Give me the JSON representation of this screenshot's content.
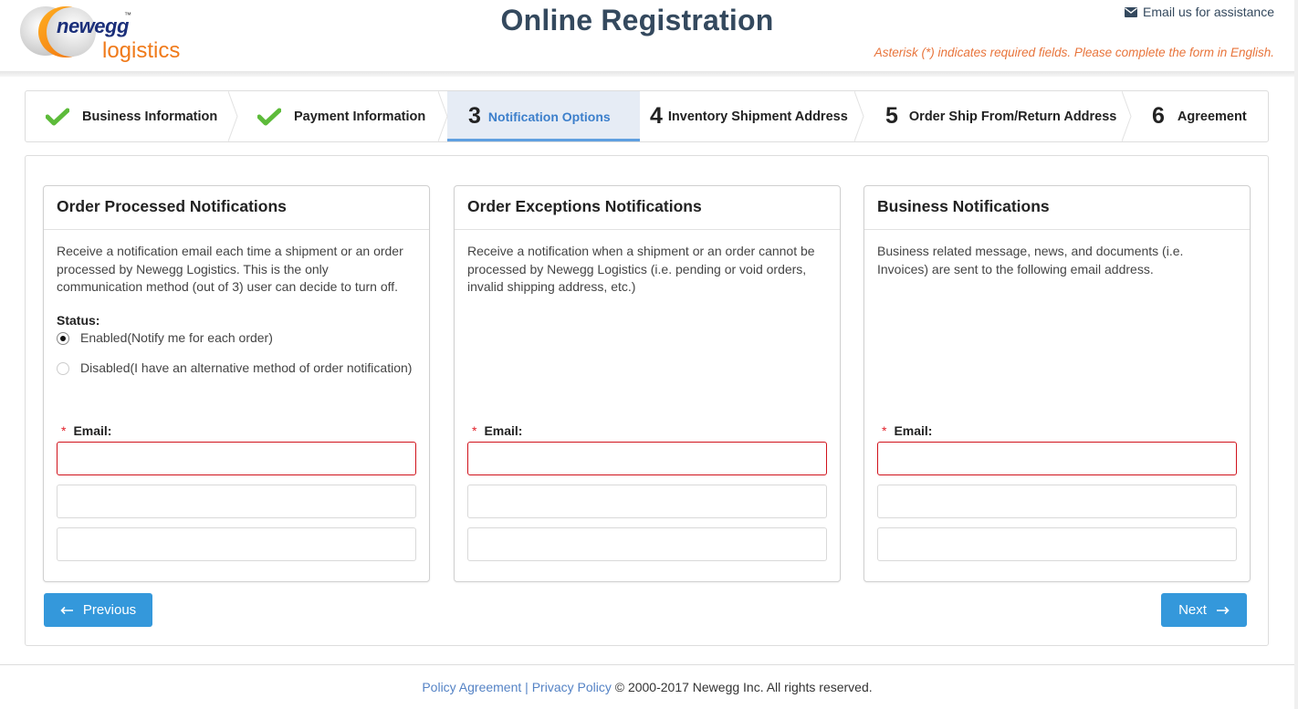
{
  "header": {
    "logo_text_top": "newegg",
    "logo_tm": "™",
    "logo_text_bottom": "logistics",
    "title": "Online Registration",
    "email_help": "Email us for assistance",
    "email_icon": "envelope-icon",
    "asterisk_note": "Asterisk (*) indicates required fields. Please complete the form in English."
  },
  "steps": [
    {
      "marker": "check",
      "icon": "checkmark-icon",
      "label": "Business Information",
      "state": "completed"
    },
    {
      "marker": "check",
      "icon": "checkmark-icon",
      "label": "Payment Information",
      "state": "completed"
    },
    {
      "marker": "3",
      "label": "Notification Options",
      "state": "active"
    },
    {
      "marker": "4",
      "label": "Inventory Shipment Address",
      "state": "pending"
    },
    {
      "marker": "5",
      "label": "Order Ship From/Return Address",
      "state": "pending"
    },
    {
      "marker": "6",
      "label": "Agreement",
      "state": "pending"
    }
  ],
  "cards": [
    {
      "title": "Order Processed Notifications",
      "description": "Receive a notification email each time a shipment or an order processed by Newegg Logistics. This is the only communication method (out of 3) user can decide to turn off.",
      "status_label": "Status:",
      "options": [
        {
          "label": "Enabled(Notify me for each order)",
          "checked": true
        },
        {
          "label": "Disabled(I have an alternative method of order notification)",
          "checked": false
        }
      ],
      "email_required_mark": "*",
      "email_label": "Email:",
      "emails": [
        "",
        "",
        ""
      ]
    },
    {
      "title": "Order Exceptions Notifications",
      "description": "Receive a notification when a shipment or an order cannot be processed by Newegg Logistics (i.e. pending or void orders, invalid shipping address, etc.)",
      "email_required_mark": "*",
      "email_label": "Email:",
      "emails": [
        "",
        "",
        ""
      ]
    },
    {
      "title": "Business Notifications",
      "description": "Business related message, news, and documents (i.e. Invoices) are sent to the following email address.",
      "email_required_mark": "*",
      "email_label": "Email:",
      "emails": [
        "",
        "",
        ""
      ]
    }
  ],
  "buttons": {
    "previous": "Previous",
    "previous_icon": "arrow-left-icon",
    "next": "Next",
    "next_icon": "arrow-right-icon"
  },
  "footer": {
    "policy_link": "Policy Agreement",
    "separator": " | ",
    "privacy_link": "Privacy Policy",
    "copyright": " © 2000-2017 Newegg Inc. All rights reserved."
  },
  "colors": {
    "title": "#34495e",
    "accent_orange": "#e8743b",
    "button_blue": "#3498db",
    "active_step_bg": "#e6ecf5",
    "active_step_text": "#3c7fcb",
    "check_green": "#5dbb3a",
    "required_red": "#d0121b",
    "link": "#5583c5"
  }
}
